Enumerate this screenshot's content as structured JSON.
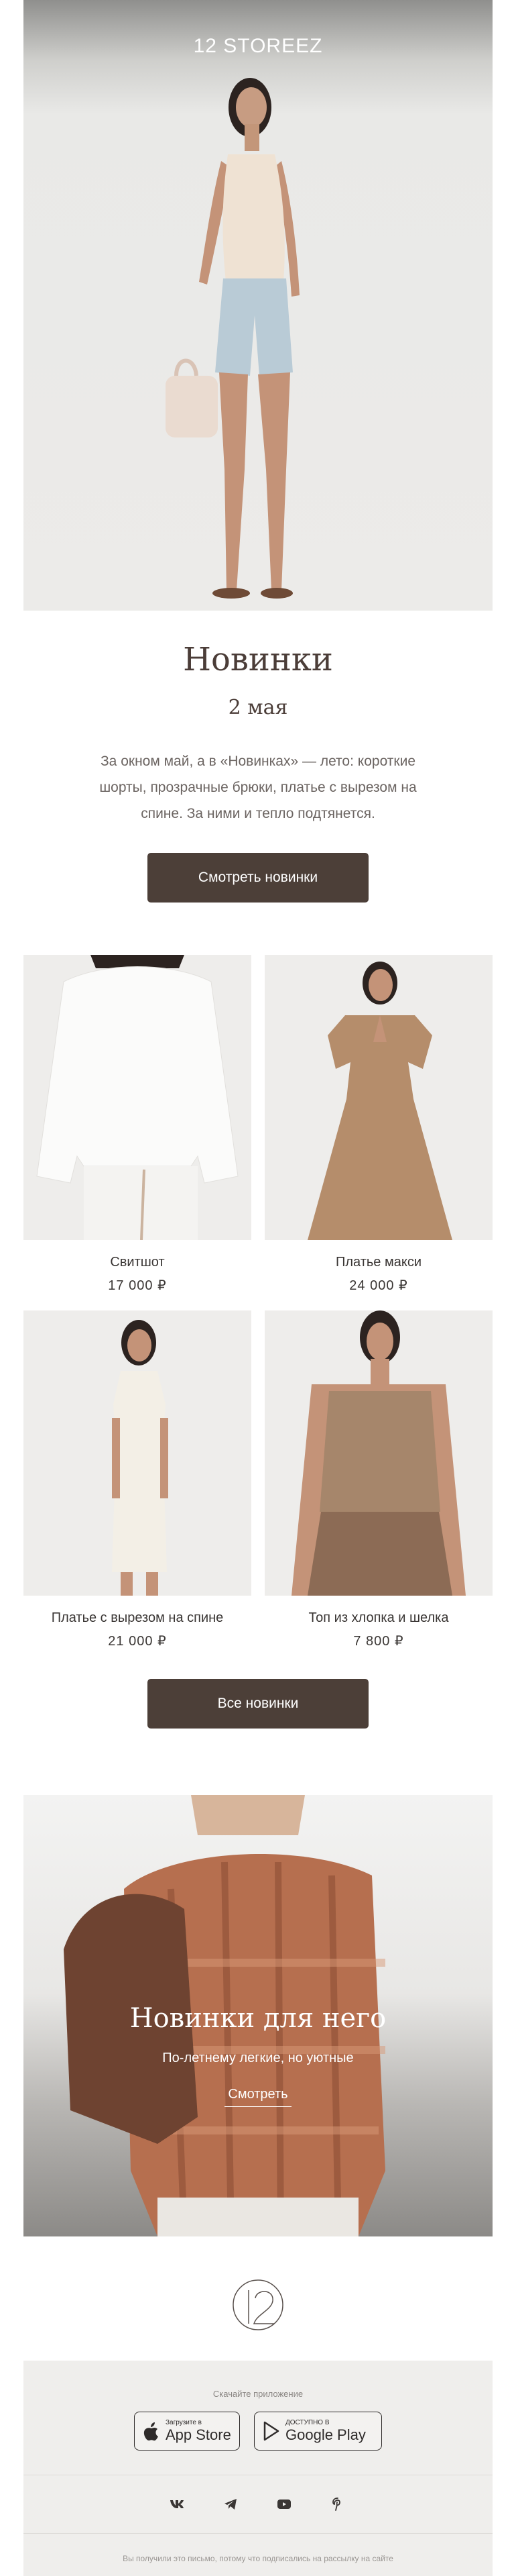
{
  "brand": {
    "name": "12 STOREEZ"
  },
  "intro": {
    "title": "Новинки",
    "date": "2 мая",
    "text": "За окном май, а в «Новинках» — лето: короткие шорты, прозрачные брюки, платье с вырезом на спине. За ними и тепло подтянется.",
    "button_label": "Смотреть новинки"
  },
  "products": [
    {
      "name": "Свитшот",
      "price": "17 000 ₽"
    },
    {
      "name": "Платье макси",
      "price": "24 000 ₽"
    },
    {
      "name": "Платье с вырезом на спине",
      "price": "21 000 ₽"
    },
    {
      "name": "Топ из хлопка и шелка",
      "price": "7 800 ₽"
    }
  ],
  "all_button_label": "Все новинки",
  "men_banner": {
    "title": "Новинки для него",
    "subtitle": "По-летнему легкие, но уютные",
    "link_label": "Смотреть"
  },
  "footer": {
    "app_caption": "Скачайте приложение",
    "app_store": {
      "small": "Загрузите в",
      "big": "App Store",
      "icon": "apple-icon"
    },
    "google_play": {
      "small": "ДОСТУПНО В",
      "big": "Google Play",
      "icon": "google-play-icon"
    },
    "social": [
      "vk-icon",
      "telegram-icon",
      "youtube-icon",
      "pinterest-icon"
    ],
    "note": "Вы получили это письмо, потому что подписались на рассылку на сайте"
  },
  "colors": {
    "button": "#4c3f38",
    "title": "#4b3d38",
    "footer_bg": "#efeeec"
  }
}
